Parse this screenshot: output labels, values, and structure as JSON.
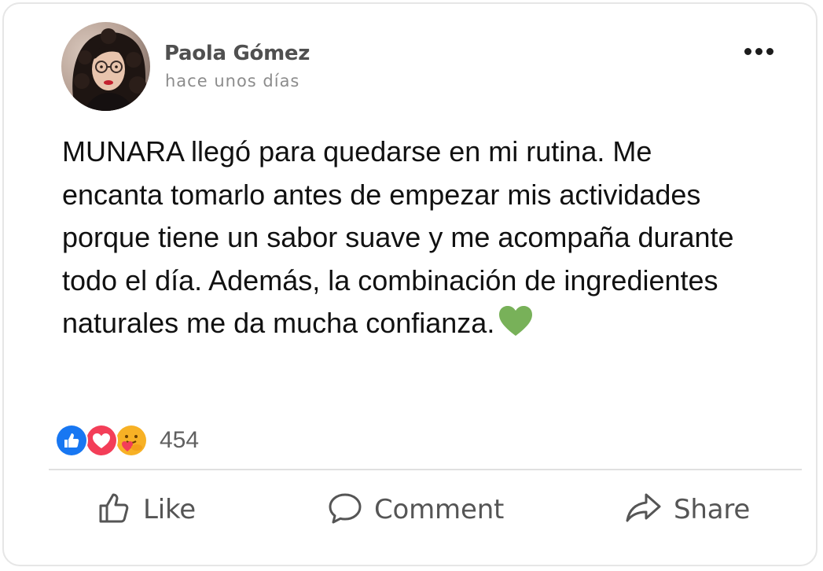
{
  "post": {
    "author_name": "Paola Gómez",
    "timestamp": "hace unos días",
    "text": "MUNARA llegó para quedarse en mi rutina. Me encanta tomarlo antes de empezar mis actividades porque tiene un sabor suave y me acompaña durante todo el día. Además, la combinación de ingredientes naturales me da mucha confianza.",
    "emoji": "green-heart"
  },
  "reactions": {
    "types": [
      "like",
      "love",
      "care"
    ],
    "count": "454",
    "colors": {
      "like": "#1877f2",
      "love": "#f33e58",
      "care": "#f7b125"
    }
  },
  "actions": {
    "like_label": "Like",
    "comment_label": "Comment",
    "share_label": "Share"
  },
  "menu": {
    "icon": "more-horizontal-icon"
  }
}
